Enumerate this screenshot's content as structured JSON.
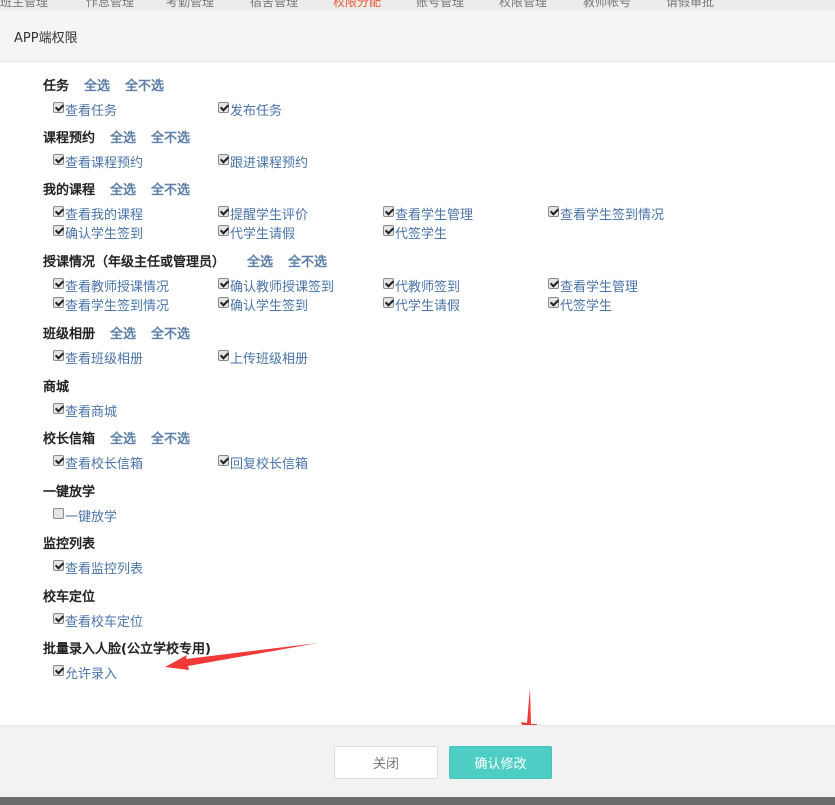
{
  "nav": {
    "tabs": [
      {
        "label": "班主管理"
      },
      {
        "label": "作息管理"
      },
      {
        "label": "考勤管理"
      },
      {
        "label": "宿舍管理"
      },
      {
        "label": "权限分配",
        "active": true
      },
      {
        "label": "账号管理"
      },
      {
        "label": "权限管理"
      },
      {
        "label": "教师帐号"
      },
      {
        "label": "请假审批"
      }
    ]
  },
  "modal": {
    "title": "APP端权限",
    "select_all": "全选",
    "select_none": "全不选",
    "sections": [
      {
        "title": "任务",
        "has_select": true,
        "rows": [
          [
            {
              "label": "查看任务",
              "checked": true
            },
            {
              "label": "发布任务",
              "checked": true
            }
          ]
        ]
      },
      {
        "title": "课程预约",
        "has_select": true,
        "rows": [
          [
            {
              "label": "查看课程预约",
              "checked": true
            },
            {
              "label": "跟进课程预约",
              "checked": true
            }
          ]
        ]
      },
      {
        "title": "我的课程",
        "has_select": true,
        "rows": [
          [
            {
              "label": "查看我的课程",
              "checked": true
            },
            {
              "label": "提醒学生评价",
              "checked": true
            },
            {
              "label": "查看学生管理",
              "checked": true
            },
            {
              "label": "查看学生签到情况",
              "checked": true
            }
          ],
          [
            {
              "label": "确认学生签到",
              "checked": true
            },
            {
              "label": "代学生请假",
              "checked": true
            },
            {
              "label": "代签学生",
              "checked": true
            }
          ]
        ]
      },
      {
        "title": "授课情况（年级主任或管理员）",
        "has_select": true,
        "rows": [
          [
            {
              "label": "查看教师授课情况",
              "checked": true
            },
            {
              "label": "确认教师授课签到",
              "checked": true
            },
            {
              "label": "代教师签到",
              "checked": true
            },
            {
              "label": "查看学生管理",
              "checked": true
            }
          ],
          [
            {
              "label": "查看学生签到情况",
              "checked": true
            },
            {
              "label": "确认学生签到",
              "checked": true
            },
            {
              "label": "代学生请假",
              "checked": true
            },
            {
              "label": "代签学生",
              "checked": true
            }
          ]
        ]
      },
      {
        "title": "班级相册",
        "has_select": true,
        "rows": [
          [
            {
              "label": "查看班级相册",
              "checked": true
            },
            {
              "label": "上传班级相册",
              "checked": true
            }
          ]
        ]
      },
      {
        "title": "商城",
        "has_select": false,
        "rows": [
          [
            {
              "label": "查看商城",
              "checked": true
            }
          ]
        ]
      },
      {
        "title": "校长信箱",
        "has_select": true,
        "rows": [
          [
            {
              "label": "查看校长信箱",
              "checked": true
            },
            {
              "label": "回复校长信箱",
              "checked": true
            }
          ]
        ]
      },
      {
        "title": "一键放学",
        "has_select": false,
        "rows": [
          [
            {
              "label": "一键放学",
              "checked": false
            }
          ]
        ]
      },
      {
        "title": "监控列表",
        "has_select": false,
        "rows": [
          [
            {
              "label": "查看监控列表",
              "checked": true
            }
          ]
        ]
      },
      {
        "title": "校车定位",
        "has_select": false,
        "rows": [
          [
            {
              "label": "查看校车定位",
              "checked": true
            }
          ]
        ]
      },
      {
        "title": "批量录入人脸(公立学校专用)",
        "has_select": false,
        "rows": [
          [
            {
              "label": "允许录入",
              "checked": true
            }
          ]
        ]
      }
    ]
  },
  "footer": {
    "close_label": "关闭",
    "confirm_label": "确认修改"
  },
  "annotations": {
    "arrow_color": "#f03a3a"
  }
}
